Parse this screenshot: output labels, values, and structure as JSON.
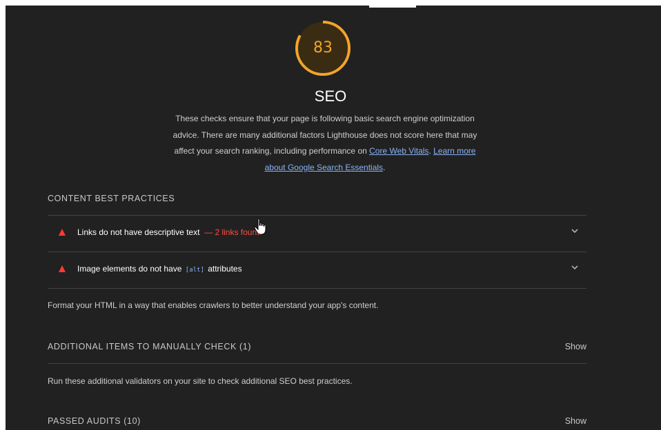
{
  "category": {
    "score": "83",
    "score_fraction": 0.83,
    "title": "SEO",
    "description": "These checks ensure that your page is following basic search engine optimization advice. There are many additional factors Lighthouse does not score here that may affect your search ranking, including performance on",
    "link_core_web_vitals": "Core Web Vitals",
    "link_separator": ".",
    "link_learn_more": "Learn more about Google Search Essentials",
    "link_end": ".",
    "gauge_color": "#f2a42b"
  },
  "content_best_practices": {
    "header": "CONTENT BEST PRACTICES",
    "audits": [
      {
        "title": "Links do not have descriptive text",
        "display_value": "— 2 links found",
        "status_icon": "warning-triangle-icon"
      },
      {
        "title_before": "Image elements do not have",
        "code": "[alt]",
        "title_after": "attributes",
        "status_icon": "warning-triangle-icon"
      }
    ],
    "description": "Format your HTML in a way that enables crawlers to better understand your app's content."
  },
  "manual_checks": {
    "header": "ADDITIONAL ITEMS TO MANUALLY CHECK (1)",
    "toggle": "Show",
    "description": "Run these additional validators on your site to check additional SEO best practices."
  },
  "passed_audits": {
    "header": "PASSED AUDITS (10)",
    "toggle": "Show"
  },
  "colors": {
    "background": "#212121",
    "fail": "#ff4e42",
    "link": "#8ab4f8",
    "average": "#f2a42b"
  }
}
